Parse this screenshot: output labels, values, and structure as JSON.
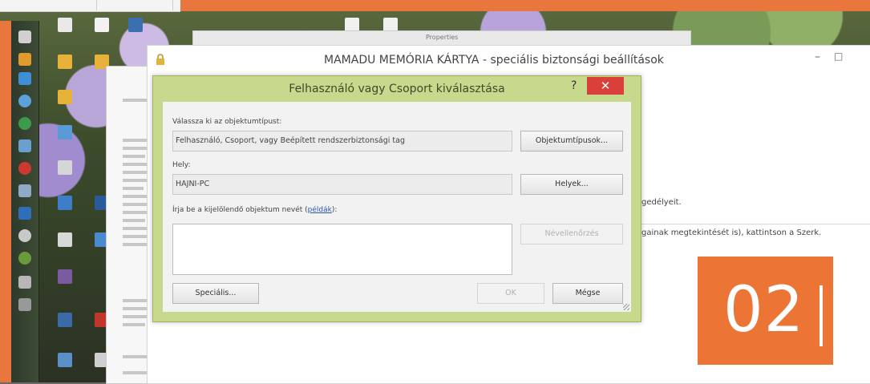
{
  "background_window": {
    "title": "Properties"
  },
  "main_window": {
    "title": "MAMADU MEMÓRIA KÁRTYA - speciális biztonsági beállítások",
    "minimize": "–",
    "maximize": "□",
    "body_text_1": "gedélyeit.",
    "body_text_2": "gainak megtekintését is), kattintson a Szerk."
  },
  "dialog": {
    "title": "Felhasználó vagy Csoport kiválasztása",
    "help": "?",
    "close": "✕",
    "object_type_label": "Válassza ki az objektumtípust:",
    "object_type_value": "Felhasználó, Csoport, vagy Beépített rendszerbiztonsági tag",
    "object_types_button": "Objektumtípusok...",
    "location_label": "Hely:",
    "location_value": "HAJNI-PC",
    "locations_button": "Helyek...",
    "names_label_prefix": "Írja be a kijelölendő objektum nevét (",
    "names_label_link": "példák",
    "names_label_suffix": "):",
    "check_names_button": "Névellenőrzés",
    "advanced_button": "Speciális...",
    "ok_button": "OK",
    "cancel_button": "Mégse"
  },
  "badge": {
    "number": "02"
  },
  "colors": {
    "accent_orange": "#ec7434",
    "dialog_frame": "#c6d98c",
    "close_red": "#d9403a",
    "link_blue": "#2a56b8"
  }
}
